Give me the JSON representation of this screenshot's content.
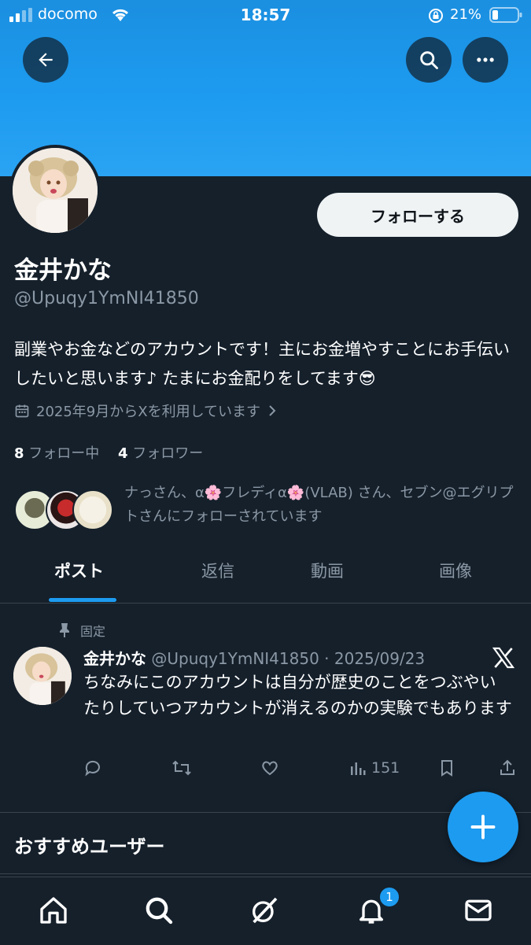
{
  "status_bar": {
    "carrier": "docomo",
    "time": "18:57",
    "battery": "21%"
  },
  "header": {
    "back_icon": "back-arrow-icon",
    "search_icon": "search-icon",
    "more_icon": "more-icon"
  },
  "profile": {
    "follow_label": "フォローする",
    "name": "金井かな",
    "handle": "@Upuqy1YmNI41850",
    "bio": "副業やお金などのアカウントです！主にお金増やすことにお手伝いしたいと思います♪ たまにお金配りをしてます😎",
    "joined": "2025年9月からXを利用しています",
    "following_count": "8",
    "following_label": "フォロー中",
    "followers_count": "4",
    "followers_label": "フォロワー",
    "followed_by": "ナっさん、α🌸フレディα🌸(VLAB) さん、セブン@エグリプトさんにフォローされています"
  },
  "tabs": [
    {
      "label": "ポスト"
    },
    {
      "label": "返信"
    },
    {
      "label": "動画"
    },
    {
      "label": "画像"
    }
  ],
  "pinned_post": {
    "pinned_label": "固定",
    "author": "金井かな",
    "meta": "@Upuqy1YmNI41850 · 2025/09/23",
    "text": "ちなみにこのアカウントは自分が歴史のことをつぶやいたりしていつアカウントが消えるのかの実験でもあります",
    "views": "151"
  },
  "recommended_title": "おすすめユーザー",
  "notifications_badge": "1",
  "colors": {
    "accent": "#1d9bf0",
    "background": "#15202b",
    "muted": "#8b98a5"
  }
}
